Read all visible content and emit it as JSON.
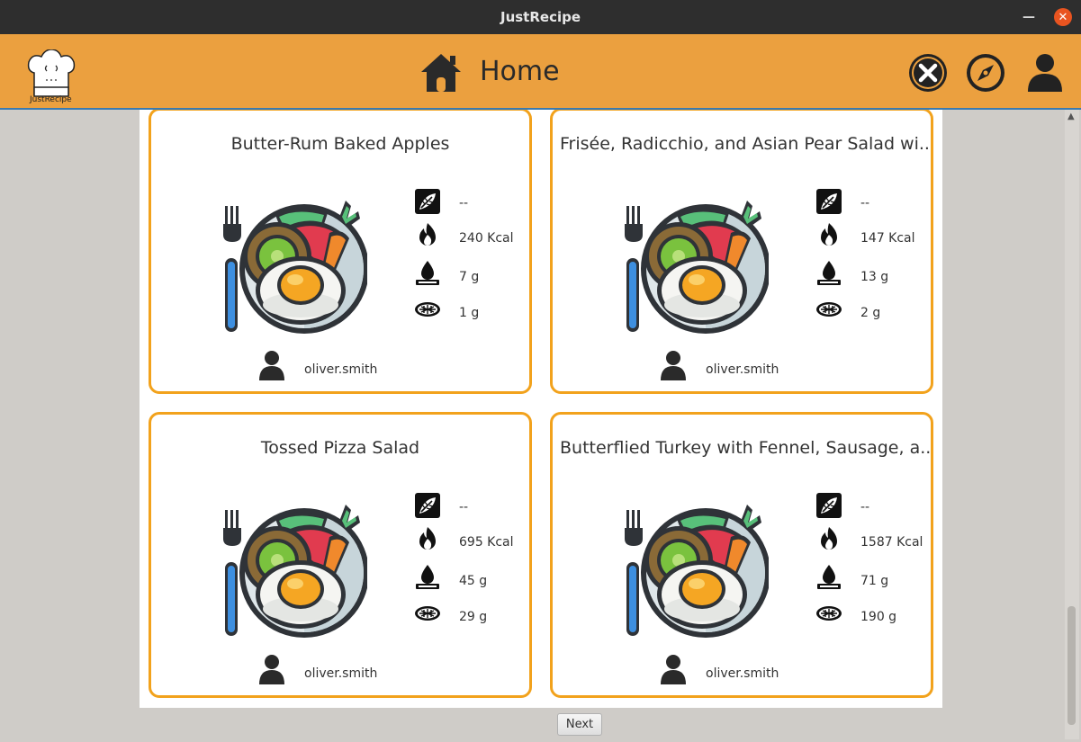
{
  "window": {
    "title": "JustRecipe"
  },
  "header": {
    "logo_text": "JustRecipe",
    "page_title": "Home",
    "icons": [
      "close-icon",
      "compass-icon",
      "user-icon"
    ],
    "accent_color": "#eba03f"
  },
  "recipes": [
    {
      "title": "Butter-Rum Baked Apples",
      "vegan": "--",
      "calories": "240 Kcal",
      "fat": "7 g",
      "protein": "1 g",
      "author": "oliver.smith"
    },
    {
      "title": "Frisée, Radicchio, and Asian Pear Salad wi...",
      "vegan": "--",
      "calories": "147 Kcal",
      "fat": "13 g",
      "protein": "2 g",
      "author": "oliver.smith"
    },
    {
      "title": "Tossed Pizza Salad",
      "vegan": "--",
      "calories": "695 Kcal",
      "fat": "45 g",
      "protein": "29 g",
      "author": "oliver.smith"
    },
    {
      "title": "Butterflied Turkey with Fennel, Sausage, a...",
      "vegan": "--",
      "calories": "1587 Kcal",
      "fat": "71 g",
      "protein": "190 g",
      "author": "oliver.smith"
    }
  ],
  "card_border_color": "#f2a21c",
  "pagination": {
    "next_label": "Next"
  }
}
